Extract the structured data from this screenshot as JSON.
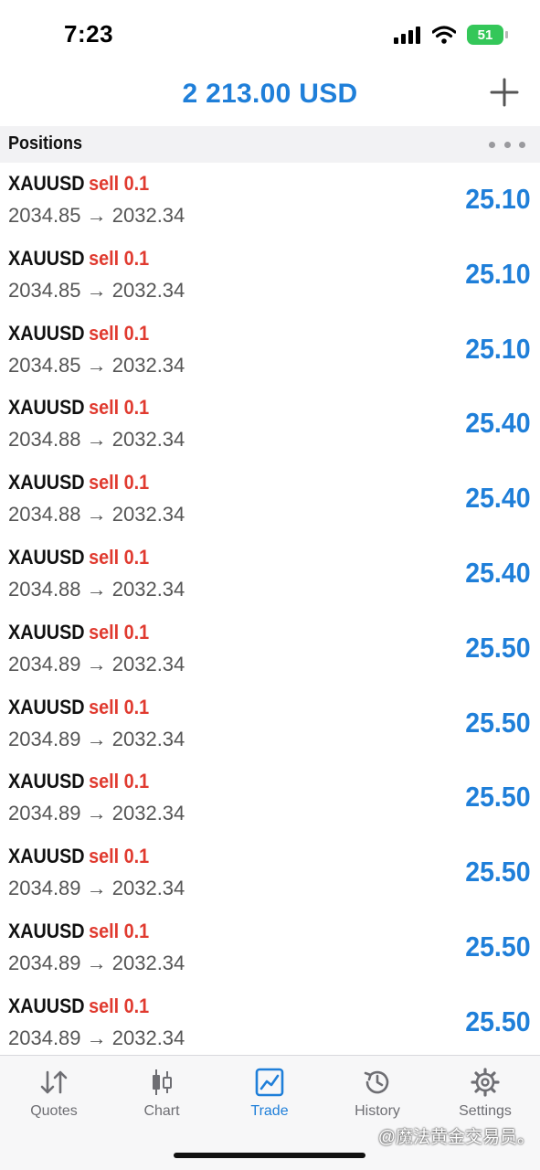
{
  "status_bar": {
    "time": "7:23",
    "battery": "51",
    "icons": [
      "signal-icon",
      "wifi-icon",
      "battery-icon"
    ]
  },
  "header": {
    "balance": "2 213.00 USD",
    "add_icon": "plus-icon"
  },
  "section": {
    "title": "Positions",
    "more_icon": "more-horizontal-icon"
  },
  "positions": [
    {
      "symbol": "XAUUSD",
      "side": "sell 0.1",
      "prices": "2034.85 → 2032.34",
      "profit": "25.10"
    },
    {
      "symbol": "XAUUSD",
      "side": "sell 0.1",
      "prices": "2034.85 → 2032.34",
      "profit": "25.10"
    },
    {
      "symbol": "XAUUSD",
      "side": "sell 0.1",
      "prices": "2034.85 → 2032.34",
      "profit": "25.10"
    },
    {
      "symbol": "XAUUSD",
      "side": "sell 0.1",
      "prices": "2034.88 → 2032.34",
      "profit": "25.40"
    },
    {
      "symbol": "XAUUSD",
      "side": "sell 0.1",
      "prices": "2034.88 → 2032.34",
      "profit": "25.40"
    },
    {
      "symbol": "XAUUSD",
      "side": "sell 0.1",
      "prices": "2034.88 → 2032.34",
      "profit": "25.40"
    },
    {
      "symbol": "XAUUSD",
      "side": "sell 0.1",
      "prices": "2034.89 → 2032.34",
      "profit": "25.50"
    },
    {
      "symbol": "XAUUSD",
      "side": "sell 0.1",
      "prices": "2034.89 → 2032.34",
      "profit": "25.50"
    },
    {
      "symbol": "XAUUSD",
      "side": "sell 0.1",
      "prices": "2034.89 → 2032.34",
      "profit": "25.50"
    },
    {
      "symbol": "XAUUSD",
      "side": "sell 0.1",
      "prices": "2034.89 → 2032.34",
      "profit": "25.50"
    },
    {
      "symbol": "XAUUSD",
      "side": "sell 0.1",
      "prices": "2034.89 → 2032.34",
      "profit": "25.50"
    },
    {
      "symbol": "XAUUSD",
      "side": "sell 0.1",
      "prices": "2034.89 → 2032.34",
      "profit": "25.50"
    }
  ],
  "tabs": [
    {
      "label": "Quotes",
      "icon": "quotes-arrows-icon",
      "active": false
    },
    {
      "label": "Chart",
      "icon": "candlestick-chart-icon",
      "active": false
    },
    {
      "label": "Trade",
      "icon": "trade-chart-icon",
      "active": true
    },
    {
      "label": "History",
      "icon": "history-clock-icon",
      "active": false
    },
    {
      "label": "Settings",
      "icon": "gear-icon",
      "active": false
    }
  ],
  "watermark": "@魔法黄金交易员。",
  "colors": {
    "accent": "#1f7fd9",
    "sell": "#e03a2f",
    "battery": "#34c759",
    "inactive_tab": "#6e6e73"
  }
}
